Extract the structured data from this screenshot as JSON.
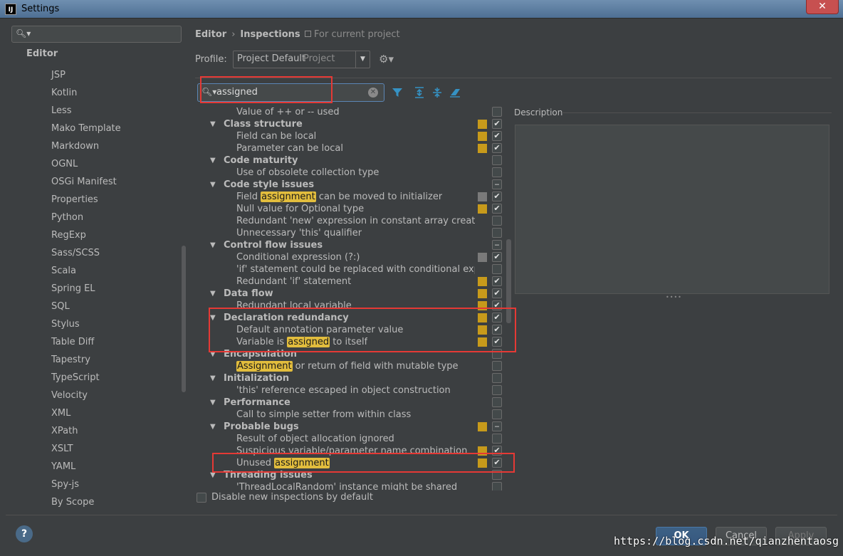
{
  "window": {
    "title": "Settings",
    "app_icon": "IJ",
    "close_glyph": "✕"
  },
  "sidebar": {
    "search_placeholder": "",
    "section_title": "Editor",
    "items": [
      "JSP",
      "Kotlin",
      "Less",
      "Mako Template",
      "Markdown",
      "OGNL",
      "OSGi Manifest",
      "Properties",
      "Python",
      "RegExp",
      "Sass/SCSS",
      "Scala",
      "Spring EL",
      "SQL",
      "Stylus",
      "Table Diff",
      "Tapestry",
      "TypeScript",
      "Velocity",
      "XML",
      "XPath",
      "XSLT",
      "YAML",
      "Spy-js",
      "By Scope"
    ]
  },
  "header": {
    "crumb1": "Editor",
    "crumb_sep": "›",
    "crumb2": "Inspections",
    "scope": "For current project"
  },
  "profile": {
    "label": "Profile:",
    "value": "Project Default",
    "sub": "Project"
  },
  "search": {
    "value": "assigned"
  },
  "colors": {
    "severity_warning": "#c79a1b",
    "severity_weak": "#7a7a7a",
    "highlight": "#e2bd3d",
    "annotation": "#e53935"
  },
  "tree": [
    {
      "type": "item",
      "text": "Value of ++ or -- used",
      "sev": "",
      "check": "empty"
    },
    {
      "type": "group",
      "text": "Class structure",
      "sev": "warn",
      "check": "checked"
    },
    {
      "type": "item",
      "text": "Field can be local",
      "sev": "warn",
      "check": "checked"
    },
    {
      "type": "item",
      "text": "Parameter can be local",
      "sev": "warn",
      "check": "checked"
    },
    {
      "type": "group",
      "text": "Code maturity",
      "sev": "",
      "check": "empty"
    },
    {
      "type": "item",
      "text": "Use of obsolete collection type",
      "sev": "",
      "check": "empty"
    },
    {
      "type": "group",
      "text": "Code style issues",
      "sev": "",
      "check": "partial"
    },
    {
      "type": "item",
      "pre": "Field ",
      "hl": "assignment",
      "post": " can be moved to initializer",
      "sev": "weak",
      "check": "checked"
    },
    {
      "type": "item",
      "text": "Null value for Optional type",
      "sev": "warn",
      "check": "checked"
    },
    {
      "type": "item",
      "text": "Redundant 'new' expression in constant array creation",
      "sev": "",
      "check": "empty"
    },
    {
      "type": "item",
      "text": "Unnecessary 'this' qualifier",
      "sev": "",
      "check": "empty"
    },
    {
      "type": "group",
      "text": "Control flow issues",
      "sev": "",
      "check": "partial"
    },
    {
      "type": "item",
      "text": "Conditional expression (?:)",
      "sev": "weak",
      "check": "checked"
    },
    {
      "type": "item",
      "text": "'if' statement could be replaced with conditional expressic",
      "sev": "",
      "check": "empty"
    },
    {
      "type": "item",
      "text": "Redundant 'if' statement",
      "sev": "warn",
      "check": "checked"
    },
    {
      "type": "group",
      "text": "Data flow",
      "sev": "warn",
      "check": "checked"
    },
    {
      "type": "item",
      "text": "Redundant local variable",
      "sev": "warn",
      "check": "checked"
    },
    {
      "type": "group",
      "text": "Declaration redundancy",
      "sev": "warn",
      "check": "checked"
    },
    {
      "type": "item",
      "text": "Default annotation parameter value",
      "sev": "warn",
      "check": "checked"
    },
    {
      "type": "item",
      "pre": "Variable is ",
      "hl": "assigned",
      "post": " to itself",
      "sev": "warn",
      "check": "checked"
    },
    {
      "type": "group",
      "text": "Encapsulation",
      "sev": "",
      "check": "empty"
    },
    {
      "type": "item",
      "pre": "",
      "hl": "Assignment",
      "post": " or return of field with mutable type",
      "sev": "",
      "check": "empty"
    },
    {
      "type": "group",
      "text": "Initialization",
      "sev": "",
      "check": "empty"
    },
    {
      "type": "item",
      "text": "'this' reference escaped in object construction",
      "sev": "",
      "check": "empty"
    },
    {
      "type": "group",
      "text": "Performance",
      "sev": "",
      "check": "empty"
    },
    {
      "type": "item",
      "text": "Call to simple setter from within class",
      "sev": "",
      "check": "empty"
    },
    {
      "type": "group",
      "text": "Probable bugs",
      "sev": "warn",
      "check": "partial"
    },
    {
      "type": "item",
      "text": "Result of object allocation ignored",
      "sev": "",
      "check": "empty"
    },
    {
      "type": "item",
      "text": "Suspicious variable/parameter name combination",
      "sev": "warn",
      "check": "checked"
    },
    {
      "type": "item",
      "pre": "Unused ",
      "hl": "assignment",
      "post": "",
      "sev": "warn",
      "check": "checked"
    },
    {
      "type": "group",
      "text": "Threading issues",
      "sev": "",
      "check": "empty"
    },
    {
      "type": "item",
      "text": "'ThreadLocalRandom' instance might be shared",
      "sev": "",
      "check": "empty"
    }
  ],
  "description": {
    "label": "Description"
  },
  "disable_new": {
    "label": "Disable new inspections by default"
  },
  "buttons": {
    "help": "?",
    "ok": "OK",
    "cancel": "Cancel",
    "apply": "Apply"
  },
  "watermark": "https://blog.csdn.net/qianzhentaosg"
}
